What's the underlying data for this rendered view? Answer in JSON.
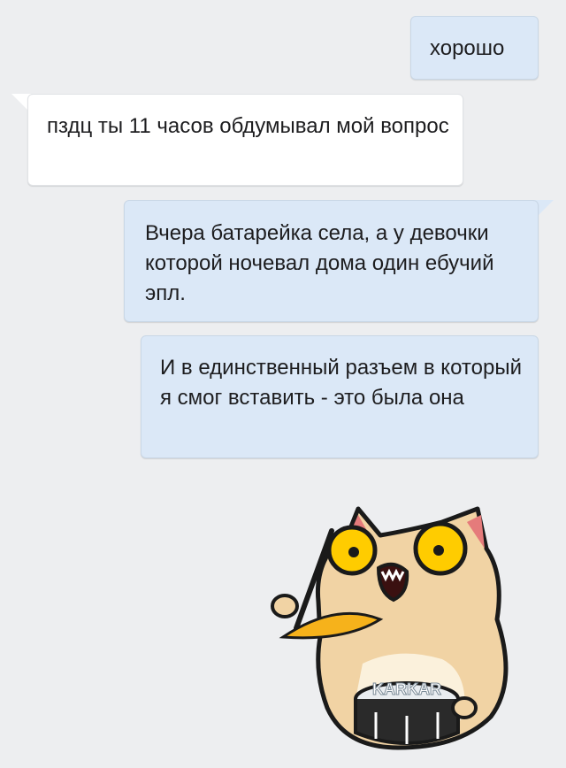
{
  "messages": [
    {
      "id": "msg1",
      "direction": "outgoing",
      "text": "хорошо"
    },
    {
      "id": "msg2",
      "direction": "incoming",
      "text": "пздц ты 11 часов обдумывал мой вопрос"
    },
    {
      "id": "msg3",
      "direction": "outgoing",
      "text": "Вчера батарейка села, а у девочки которой ночевал дома один ебучий эпл."
    },
    {
      "id": "msg4",
      "direction": "outgoing",
      "text": "И в единственный разъем в который я смог вставить - это была она"
    }
  ],
  "sticker": {
    "icon": "drumming-cat-sticker",
    "label": "KARKAR"
  },
  "colors": {
    "background": "#edeef0",
    "outgoing_bubble": "#dbe8f7",
    "incoming_bubble": "#ffffff"
  }
}
